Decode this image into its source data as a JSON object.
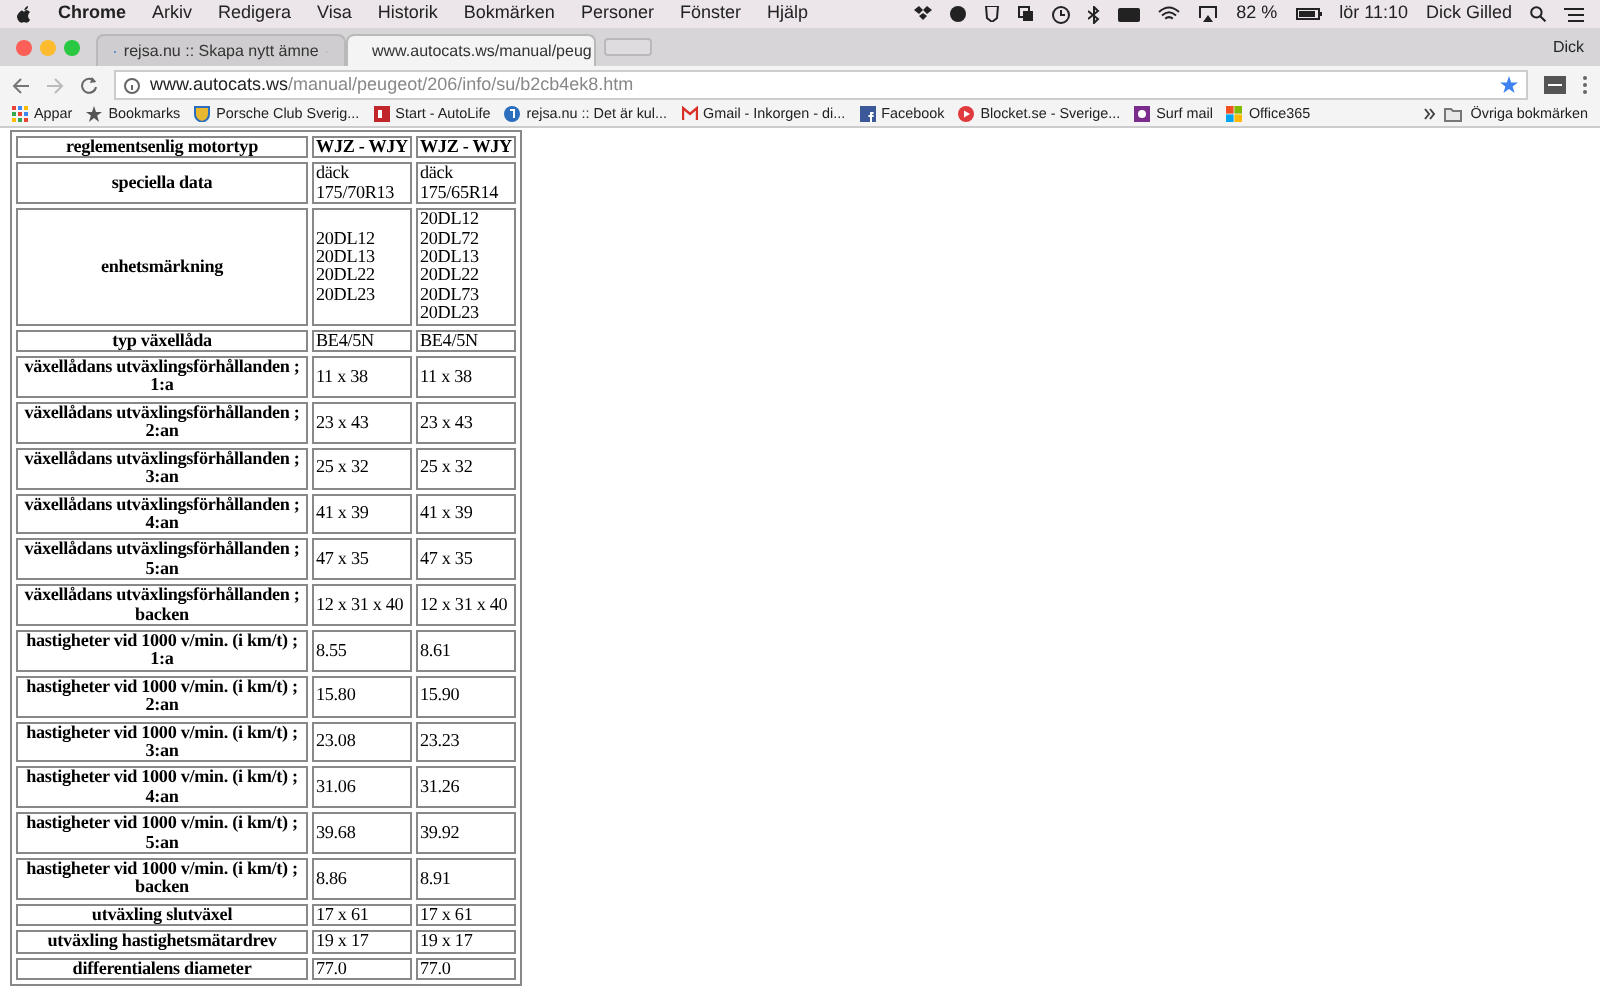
{
  "menu_bar": {
    "app": "Chrome",
    "items": [
      "Arkiv",
      "Redigera",
      "Visa",
      "Historik",
      "Bokmärken",
      "Personer",
      "Fönster",
      "Hjälp"
    ],
    "battery": "82 %",
    "clock": "lör 11:10",
    "user": "Dick Gilled"
  },
  "tabs": [
    {
      "title": "rejsa.nu :: Skapa nytt ämne",
      "selected": false
    },
    {
      "title": "www.autocats.ws/manual/peug",
      "selected": true
    }
  ],
  "profile": "Dick",
  "address": {
    "host": "www.autocats.ws",
    "path": "/manual/peugeot/206/info/su/b2cb4ek8.htm"
  },
  "bookmarks": [
    {
      "label": "Appar",
      "kind": "apps"
    },
    {
      "label": "Bookmarks",
      "kind": "star"
    },
    {
      "label": "Porsche Club Sverig...",
      "kind": "crest"
    },
    {
      "label": "Start - AutoLife",
      "kind": "red"
    },
    {
      "label": "rejsa.nu :: Det är kul...",
      "kind": "rejsa"
    },
    {
      "label": "Gmail - Inkorgen - di...",
      "kind": "gmail"
    },
    {
      "label": "Facebook",
      "kind": "facebook"
    },
    {
      "label": "Blocket.se - Sverige...",
      "kind": "blocket"
    },
    {
      "label": "Surf mail",
      "kind": "surf"
    },
    {
      "label": "Office365",
      "kind": "office"
    }
  ],
  "other_bookmarks": "Övriga bokmärken",
  "table": {
    "rows": [
      {
        "label": "reglementsenlig motortyp",
        "values": [
          "WJZ - WJY",
          "WJZ - WJY"
        ],
        "header": true
      },
      {
        "label": "speciella data",
        "values": [
          "däck\n175/70R13",
          "däck\n175/65R14"
        ],
        "header": false
      },
      {
        "label": "enhetsmärkning",
        "values": [
          "20DL12\n20DL13\n20DL22\n20DL23",
          "20DL12\n20DL72\n20DL13\n20DL22\n20DL73\n20DL23"
        ],
        "header": false
      },
      {
        "label": "typ växellåda",
        "values": [
          "BE4/5N",
          "BE4/5N"
        ],
        "header": false
      },
      {
        "label": "växellådans utväxlingsförhållanden ; 1:a",
        "values": [
          "11 x 38",
          "11 x 38"
        ],
        "header": false
      },
      {
        "label": "växellådans utväxlingsförhållanden ; 2:an",
        "values": [
          "23 x 43",
          "23 x 43"
        ],
        "header": false
      },
      {
        "label": "växellådans utväxlingsförhållanden ; 3:an",
        "values": [
          "25 x 32",
          "25 x 32"
        ],
        "header": false
      },
      {
        "label": "växellådans utväxlingsförhållanden ; 4:an",
        "values": [
          "41 x 39",
          "41 x 39"
        ],
        "header": false
      },
      {
        "label": "växellådans utväxlingsförhållanden ; 5:an",
        "values": [
          "47 x 35",
          "47 x 35"
        ],
        "header": false
      },
      {
        "label": "växellådans utväxlingsförhållanden ; backen",
        "values": [
          "12 x 31 x 40",
          "12 x 31 x 40"
        ],
        "header": false
      },
      {
        "label": "hastigheter vid 1000 v/min. (i km/t) ; 1:a",
        "values": [
          "8.55",
          "8.61"
        ],
        "header": false
      },
      {
        "label": "hastigheter vid 1000 v/min. (i km/t) ; 2:an",
        "values": [
          "15.80",
          "15.90"
        ],
        "header": false
      },
      {
        "label": "hastigheter vid 1000 v/min. (i km/t) ; 3:an",
        "values": [
          "23.08",
          "23.23"
        ],
        "header": false
      },
      {
        "label": "hastigheter vid 1000 v/min. (i km/t) ; 4:an",
        "values": [
          "31.06",
          "31.26"
        ],
        "header": false
      },
      {
        "label": "hastigheter vid 1000 v/min. (i km/t) ; 5:an",
        "values": [
          "39.68",
          "39.92"
        ],
        "header": false
      },
      {
        "label": "hastigheter vid 1000 v/min. (i km/t) ; backen",
        "values": [
          "8.86",
          "8.91"
        ],
        "header": false
      },
      {
        "label": "utväxling slutväxel",
        "values": [
          "17 x 61",
          "17 x 61"
        ],
        "header": false
      },
      {
        "label": "utväxling hastighetsmätardrev",
        "values": [
          "19 x 17",
          "19 x 17"
        ],
        "header": false
      },
      {
        "label": "differentialens diameter",
        "values": [
          "77.0",
          "77.0"
        ],
        "header": false
      }
    ]
  }
}
